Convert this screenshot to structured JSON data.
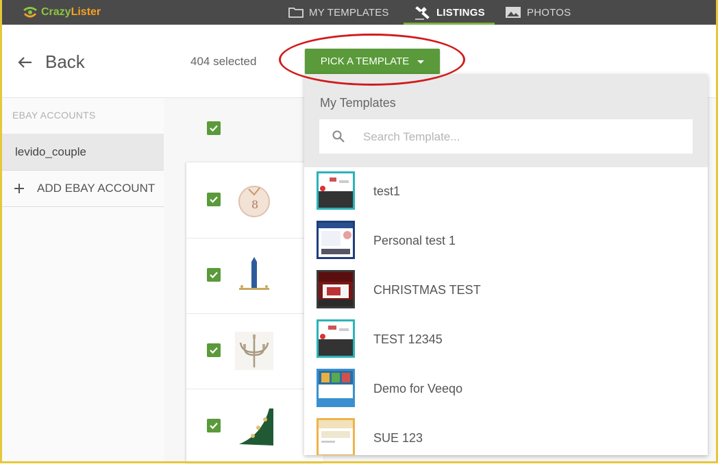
{
  "brand": {
    "name_part1": "Crazy",
    "name_part2": "Lister",
    "accent": "#8cc63f",
    "accent2": "#f6a123"
  },
  "nav": [
    {
      "label": "MY TEMPLATES",
      "icon": "folder-icon",
      "active": false
    },
    {
      "label": "LISTINGS",
      "icon": "gavel-icon",
      "active": true
    },
    {
      "label": "PHOTOS",
      "icon": "image-icon",
      "active": false
    }
  ],
  "header": {
    "back_label": "Back",
    "selected_text": "404 selected",
    "pick_label": "PICK A TEMPLATE"
  },
  "sidebar": {
    "title": "EBAY ACCOUNTS",
    "account": "levido_couple",
    "add_label": "ADD EBAY ACCOUNT"
  },
  "listings": {
    "select_all_checked": true,
    "rows": [
      {
        "checked": true,
        "image": "jewelry-pendant"
      },
      {
        "checked": true,
        "image": "tower-menorah"
      },
      {
        "checked": true,
        "image": "candelabra"
      },
      {
        "checked": true,
        "image": "green-fabric"
      }
    ]
  },
  "dropdown": {
    "title": "My Templates",
    "search_placeholder": "Search Template...",
    "templates": [
      {
        "name": "test1",
        "frame_color": "#2ab3b8"
      },
      {
        "name": "Personal test 1",
        "frame_color": "#1f3d7a"
      },
      {
        "name": "CHRISTMAS TEST",
        "frame_color": "#3a3a3a"
      },
      {
        "name": "TEST 12345",
        "frame_color": "#2ab3b8"
      },
      {
        "name": "Demo for Veeqo",
        "frame_color": "#3a8fd0"
      },
      {
        "name": "SUE 123",
        "frame_color": "#f0b24a"
      }
    ]
  },
  "colors": {
    "primary_green": "#5a9a3a",
    "highlight_ring": "#d11b1b",
    "topbar": "#4a4a4a"
  }
}
